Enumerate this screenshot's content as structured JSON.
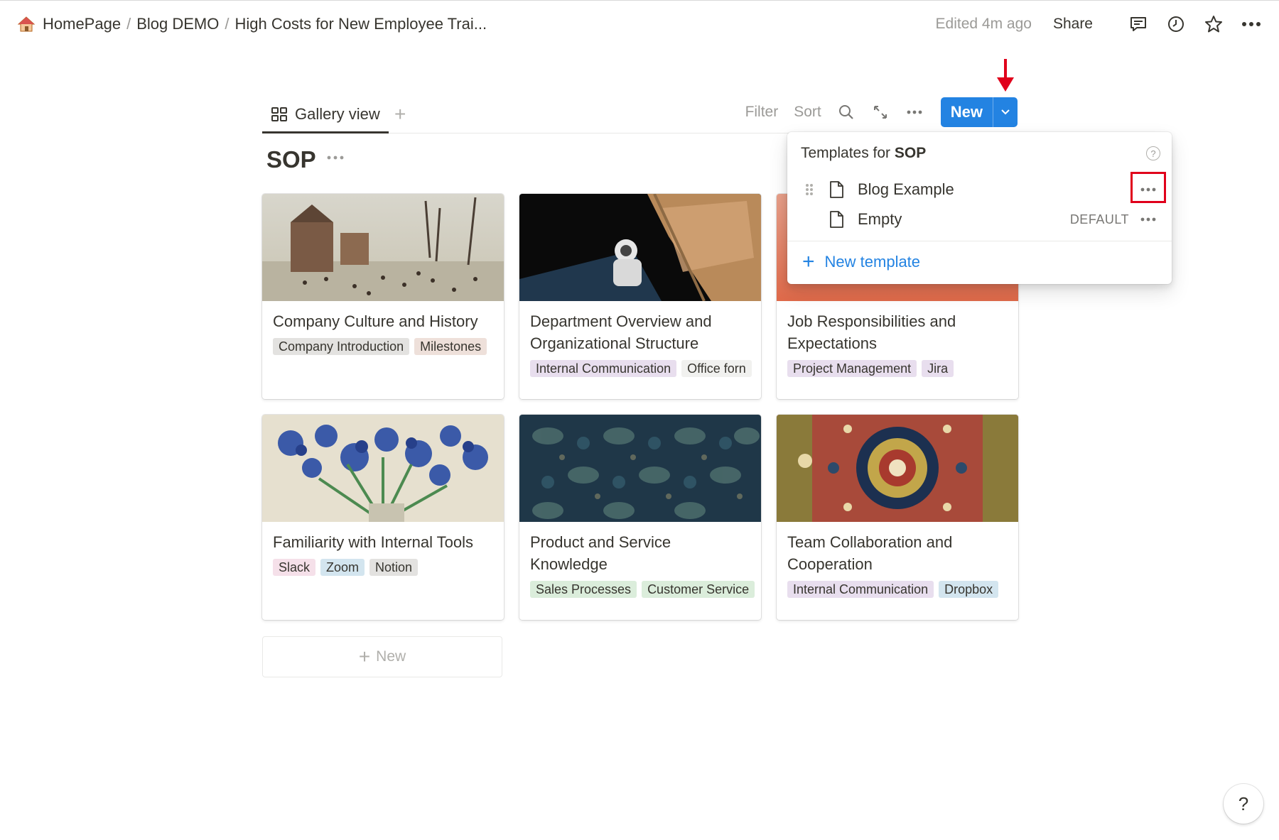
{
  "breadcrumb": {
    "items": [
      "HomePage",
      "Blog DEMO",
      "High Costs for New Employee Trai..."
    ],
    "separator": "/"
  },
  "topbar": {
    "edited": "Edited 4m ago",
    "share": "Share"
  },
  "view": {
    "tab_label": "Gallery view",
    "add_view": "+",
    "filter": "Filter",
    "sort": "Sort",
    "new_label": "New"
  },
  "database": {
    "title": "SOP"
  },
  "cards": [
    {
      "title": "Company Culture and History",
      "cover": "winter-landscape-painting",
      "tags": [
        {
          "label": "Company Introduction",
          "color": "#e3e2e0"
        },
        {
          "label": "Milestones",
          "color": "#eee0da"
        }
      ]
    },
    {
      "title": "Department Overview and Organizational Structure",
      "cover": "astronaut-space-station",
      "tags": [
        {
          "label": "Internal Communication",
          "color": "#e8deee"
        },
        {
          "label": "Office forn",
          "color": "#f1f1ef"
        }
      ]
    },
    {
      "title": "Job Responsibilities and Expectations",
      "cover": "red-gradient",
      "tags": [
        {
          "label": "Project Management",
          "color": "#e8deee"
        },
        {
          "label": "Jira",
          "color": "#e8deee"
        }
      ]
    },
    {
      "title": "Familiarity with Internal Tools",
      "cover": "irises-painting",
      "tags": [
        {
          "label": "Slack",
          "color": "#f5e0e9"
        },
        {
          "label": "Zoom",
          "color": "#d3e5ef"
        },
        {
          "label": "Notion",
          "color": "#e3e2e0"
        }
      ]
    },
    {
      "title": "Product and Service Knowledge",
      "cover": "bird-pattern-textile",
      "tags": [
        {
          "label": "Sales Processes",
          "color": "#dbeddb"
        },
        {
          "label": "Customer Service",
          "color": "#dbeddb"
        }
      ]
    },
    {
      "title": "Team Collaboration and Cooperation",
      "cover": "persian-rug",
      "tags": [
        {
          "label": "Internal Communication",
          "color": "#e8deee"
        },
        {
          "label": "Dropbox",
          "color": "#d3e5ef"
        }
      ]
    }
  ],
  "add_card": {
    "label": "New"
  },
  "templates_popup": {
    "title_prefix": "Templates for ",
    "title_db": "SOP",
    "help": "?",
    "items": [
      {
        "name": "Blog Example",
        "badge": ""
      },
      {
        "name": "Empty",
        "badge": "DEFAULT"
      }
    ],
    "new_template": "New template"
  },
  "help_button": "?",
  "colors": {
    "accent": "#2383e2",
    "annotation": "#e0001b",
    "text": "#37352f",
    "muted": "#9b9a97"
  }
}
